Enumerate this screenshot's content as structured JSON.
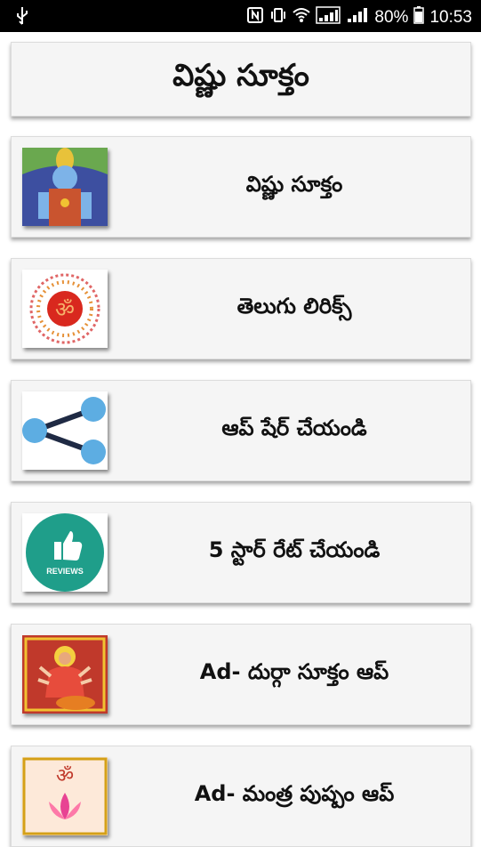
{
  "status_bar": {
    "battery": "80%",
    "time": "10:53"
  },
  "header": {
    "title": "విష్ణు సూక్తం"
  },
  "items": [
    {
      "label": "విష్ణు సూక్తం",
      "icon": "vishnu-image-icon"
    },
    {
      "label": "తెలుగు లిరిక్స్",
      "icon": "om-mandala-icon"
    },
    {
      "label": "ఆప్ షేర్ చేయండి",
      "icon": "share-icon"
    },
    {
      "label": "5 స్టార్ రేట్ చేయండి",
      "icon": "reviews-thumbs-up-icon",
      "icon_text": "REVIEWS"
    },
    {
      "label": "Ad- దుర్గా సూక్తం ఆప్",
      "icon": "durga-image-icon"
    },
    {
      "label": "Ad- మంత్ర పుష్పం ఆప్",
      "icon": "lotus-om-icon"
    }
  ]
}
